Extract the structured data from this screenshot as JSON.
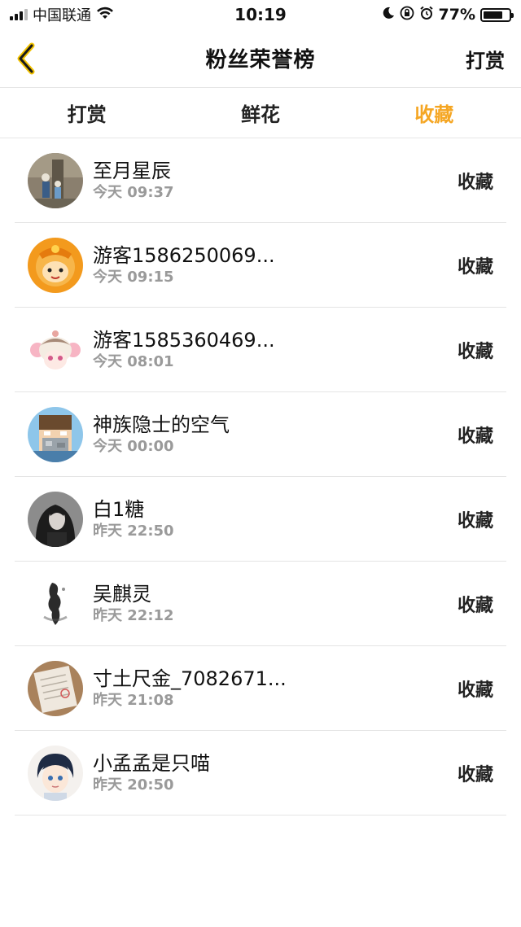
{
  "status_bar": {
    "carrier": "中国联通",
    "time": "10:19",
    "battery": "77%",
    "battery_level": 0.77
  },
  "nav": {
    "title": "粉丝荣誉榜",
    "right_action": "打赏",
    "back_icon": "chevron-left-icon",
    "accent": "#f5a623"
  },
  "tabs": [
    {
      "label": "打赏",
      "active": false
    },
    {
      "label": "鲜花",
      "active": false
    },
    {
      "label": "收藏",
      "active": true
    }
  ],
  "list": [
    {
      "name": "至月星辰",
      "time": "今天 09:37",
      "action": "收藏"
    },
    {
      "name": "游客1586250069...",
      "time": "今天 09:15",
      "action": "收藏"
    },
    {
      "name": "游客1585360469...",
      "time": "今天 08:01",
      "action": "收藏"
    },
    {
      "name": "神族隐士的空气",
      "time": "今天 00:00",
      "action": "收藏"
    },
    {
      "name": "白1糖",
      "time": "昨天 22:50",
      "action": "收藏"
    },
    {
      "name": "吴麒灵",
      "time": "昨天 22:12",
      "action": "收藏"
    },
    {
      "name": "寸土尺金_7082671...",
      "time": "昨天 21:08",
      "action": "收藏"
    },
    {
      "name": "小孟孟是只喵",
      "time": "昨天 20:50",
      "action": "收藏"
    }
  ]
}
